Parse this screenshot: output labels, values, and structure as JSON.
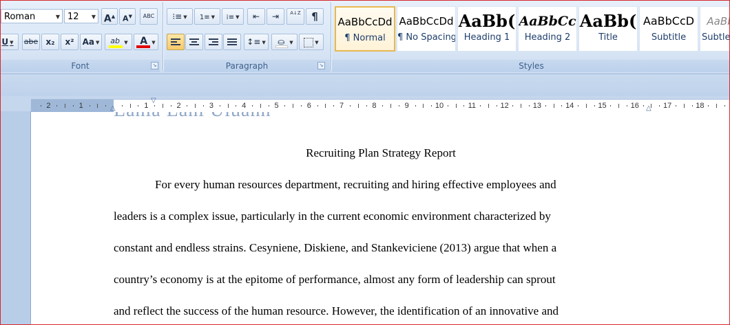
{
  "ribbon": {
    "font": {
      "family_value": "Roman",
      "size_value": "12",
      "grow_label": "A",
      "shrink_label": "A",
      "clear_label": "ABC",
      "underline_label": "U",
      "strike_label": "abe",
      "subscript_label": "x₂",
      "superscript_label": "x²",
      "case_label": "Aa",
      "highlight_label": "ab",
      "color_label": "A",
      "group_label": "Font"
    },
    "paragraph": {
      "show_marks_label": "¶",
      "sort_label": "A↓Z",
      "group_label": "Paragraph"
    },
    "styles": {
      "group_label": "Styles",
      "items": [
        {
          "preview": "AaBbCcDd",
          "name": "¶ Normal"
        },
        {
          "preview": "AaBbCcDd",
          "name": "¶ No Spacing"
        },
        {
          "preview": "AaBb(",
          "name": "Heading 1"
        },
        {
          "preview": "AaBbCc",
          "name": "Heading 2"
        },
        {
          "preview": "AaBb(",
          "name": "Title"
        },
        {
          "preview": "AaBbCcD",
          "name": "Subtitle"
        },
        {
          "preview": "AaBb",
          "name": "Subtle"
        }
      ]
    }
  },
  "ruler": {
    "numbers": [
      "2",
      "1",
      "1",
      "2",
      "3",
      "4",
      "5",
      "6",
      "7",
      "8",
      "9",
      "10",
      "11",
      "12",
      "13",
      "14",
      "15",
      "16",
      "17",
      "18"
    ]
  },
  "document": {
    "ghost_text": "Lahia Lahi Uiuahh",
    "title": "Recruiting Plan Strategy Report",
    "lines": [
      "For every human resources department, recruiting and hiring effective employees and",
      "leaders is a complex issue, particularly in the current economic environment characterized by",
      "constant and endless strains. Cesyniene, Diskiene, and Stankeviciene (2013) argue that when a",
      "country’s economy is at the epitome of performance, almost any form of leadership can sprout",
      "and reflect the success of the human resource. However, the identification of an innovative and"
    ]
  },
  "colors": {
    "highlight": "#ffff00",
    "font_color": "#e00000",
    "selected_style_border": "#e8b84f",
    "window_border": "#d9262c"
  }
}
